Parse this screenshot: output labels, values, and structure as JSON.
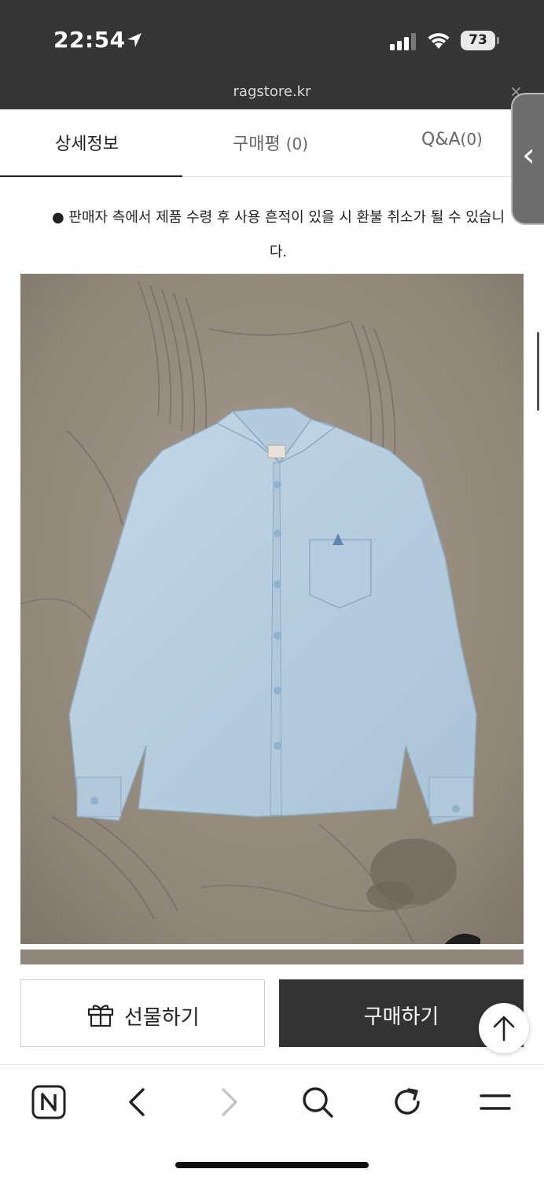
{
  "status_bar": {
    "time": "22:54",
    "battery": "73"
  },
  "browser": {
    "url": "ragstore.kr",
    "close_symbol": "×"
  },
  "tabs": [
    {
      "label": "상세정보",
      "count": ""
    },
    {
      "label": "구매평",
      "count": "(0)"
    },
    {
      "label": "Q&A",
      "count": "(0)"
    }
  ],
  "notice": {
    "line1": "● 판매자 측에서 제품 수령 후 사용 흔적이 있을 시 환불 취소가 될 수 있습니",
    "line2": "다."
  },
  "product_image": {
    "subject": "light blue long-sleeve shirt with chest pocket on concrete floor"
  },
  "actions": {
    "gift_label": "선물하기",
    "buy_label": "구매하기"
  },
  "icons": {
    "location": "location-arrow-icon",
    "gift": "gift-icon",
    "scroll_top": "arrow-up-icon",
    "naver": "naver-logo-icon",
    "back": "chevron-left-icon",
    "forward": "chevron-right-icon",
    "search": "search-icon",
    "reload": "reload-icon",
    "menu": "menu-icon"
  },
  "colors": {
    "status_bg": "#353535",
    "buy_button": "#333333",
    "shirt": "#b7cfe0"
  }
}
